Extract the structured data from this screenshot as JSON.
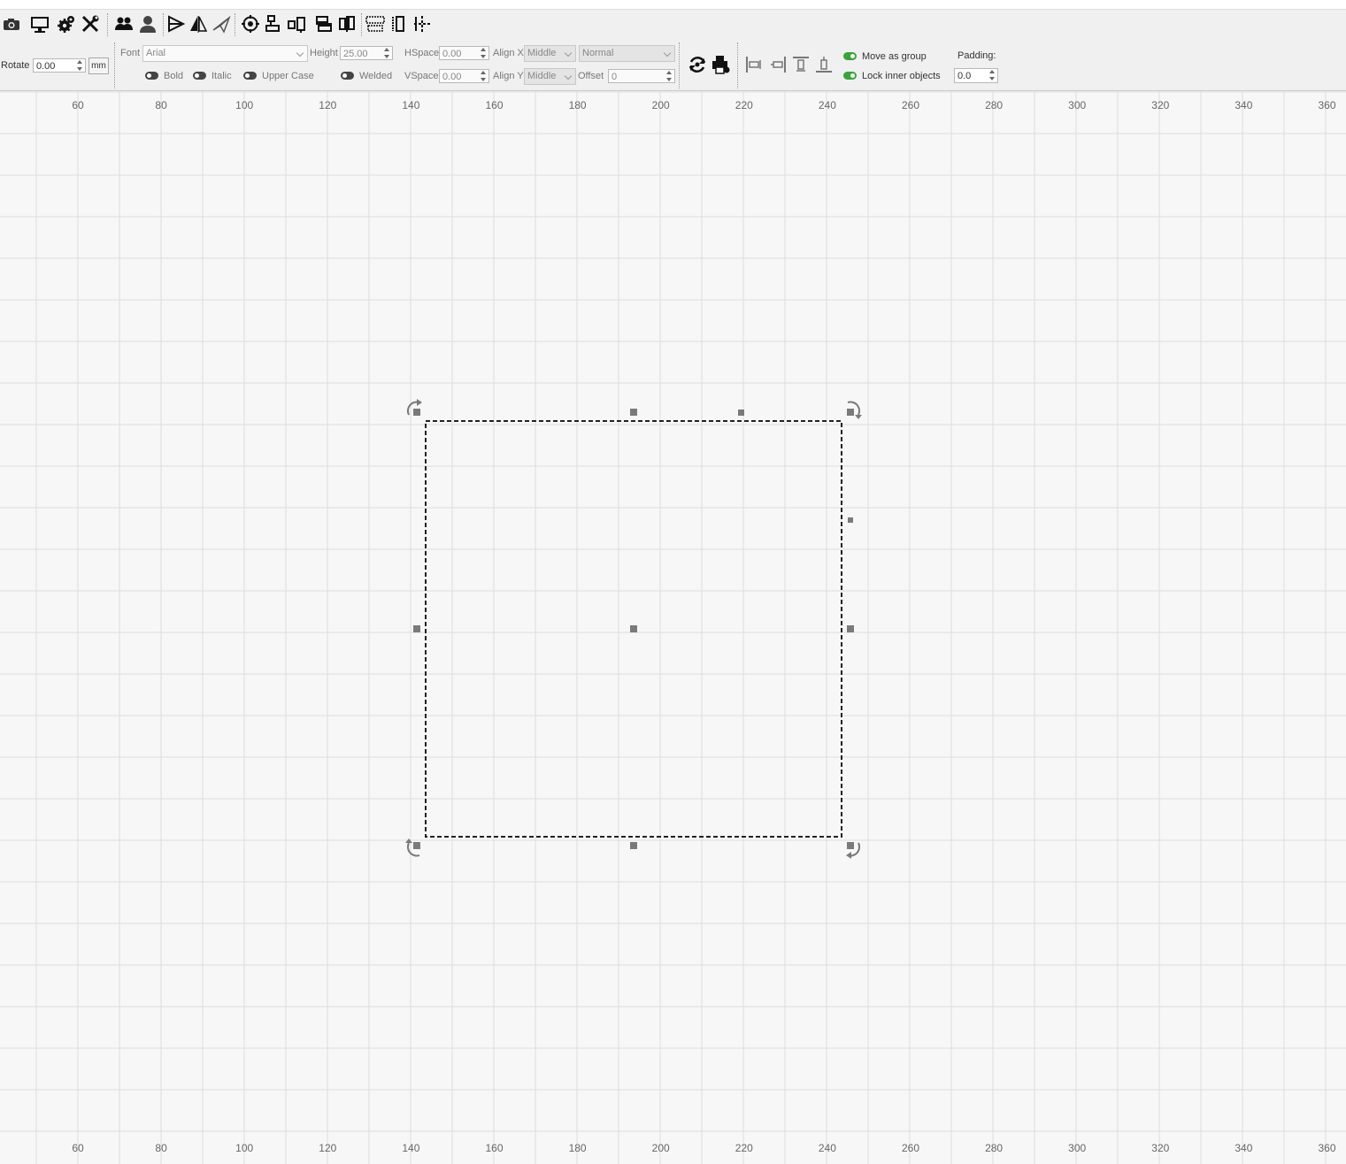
{
  "toolbar1": {
    "icons": [
      "camera-icon",
      "monitor-icon",
      "gear-icon",
      "tools-icon",
      "group-users-icon",
      "user-icon",
      "flip-horizontal-icon",
      "mirror-icon",
      "send-icon",
      "target-icon",
      "align-nodes-icon",
      "resize-icon",
      "distribute-v-icon",
      "distribute-h-icon",
      "dock-icon",
      "split-icon",
      "move-cross-icon"
    ]
  },
  "toolbar2": {
    "rotate": {
      "label": "Rotate",
      "value": "0.00",
      "unit_button": "mm"
    },
    "font": {
      "label": "Font",
      "value": "Arial"
    },
    "height": {
      "label": "Height",
      "value": "25.00"
    },
    "hspace": {
      "label": "HSpace",
      "value": "0.00"
    },
    "vspace": {
      "label": "VSpace",
      "value": "0.00"
    },
    "align_x": {
      "label": "Align X",
      "value": "Middle"
    },
    "align_y": {
      "label": "Align Y",
      "value": "Middle"
    },
    "style": {
      "value": "Normal"
    },
    "offset": {
      "label": "Offset",
      "value": "0"
    },
    "bold": {
      "label": "Bold",
      "on": false
    },
    "italic": {
      "label": "Italic",
      "on": false
    },
    "upper_case": {
      "label": "Upper Case",
      "on": false
    },
    "welded": {
      "label": "Welded",
      "on": false
    },
    "move_as_group": {
      "label": "Move as group",
      "on": true
    },
    "lock_inner": {
      "label": "Lock inner objects",
      "on": true
    },
    "padding": {
      "label": "Padding:",
      "value": "0.0"
    }
  },
  "ruler": {
    "ticks": [
      "60",
      "80",
      "100",
      "120",
      "140",
      "160",
      "180",
      "200",
      "220",
      "240",
      "260",
      "280",
      "300",
      "320",
      "340",
      "360"
    ]
  },
  "colors": {
    "grid": "#dedede",
    "handle": "#7a7a7a",
    "selection": "#222222",
    "toggle_on": "#3aa33a"
  }
}
